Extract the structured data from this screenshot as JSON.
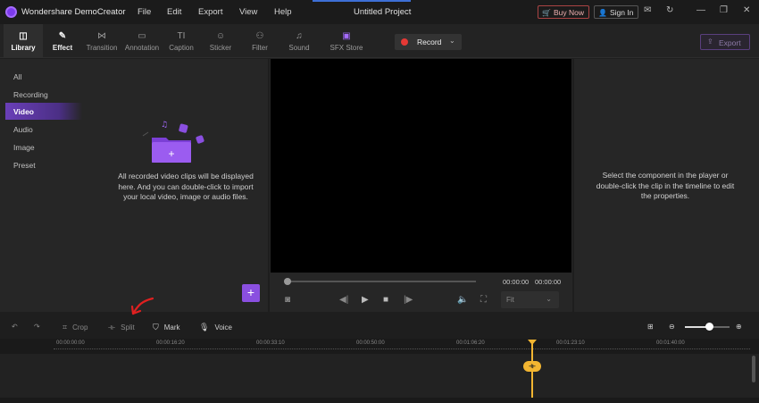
{
  "titlebar": {
    "app_name": "Wondershare DemoCreator",
    "menu": [
      "File",
      "Edit",
      "Export",
      "View",
      "Help"
    ],
    "project_title": "Untitled Project",
    "buy_label": "Buy Now",
    "signin_label": "Sign In"
  },
  "toolbar": {
    "tools": [
      {
        "label": "Library",
        "icon": "library-icon"
      },
      {
        "label": "Effect",
        "icon": "effect-icon"
      },
      {
        "label": "Transition",
        "icon": "transition-icon"
      },
      {
        "label": "Annotation",
        "icon": "annotation-icon"
      },
      {
        "label": "Caption",
        "icon": "caption-icon"
      },
      {
        "label": "Sticker",
        "icon": "sticker-icon"
      },
      {
        "label": "Filter",
        "icon": "filter-icon"
      },
      {
        "label": "Sound",
        "icon": "sound-icon"
      },
      {
        "label": "SFX Store",
        "icon": "sfx-store-icon"
      }
    ],
    "record_label": "Record",
    "export_label": "Export"
  },
  "sidebar": {
    "items": [
      {
        "label": "All"
      },
      {
        "label": "Recording"
      },
      {
        "label": "Video",
        "active": true
      },
      {
        "label": "Audio"
      },
      {
        "label": "Image"
      },
      {
        "label": "Preset"
      }
    ]
  },
  "library": {
    "empty_message": "All recorded video clips will be displayed here. And you can double-click to import your local video, image or audio files."
  },
  "player": {
    "current_time": "00:00:00",
    "total_time": "00:00:00",
    "fit_option": "Fit"
  },
  "properties": {
    "message": "Select the component in the player or double-click the clip in the timeline to edit the properties."
  },
  "timeline": {
    "tools": {
      "crop": "Crop",
      "split": "Split",
      "mark": "Mark",
      "voice": "Voice"
    },
    "ruler_ticks": [
      "00:00:00:00",
      "00:00:16:20",
      "00:00:33:10",
      "00:00:50:00",
      "00:01:06:20",
      "00:01:23:10",
      "00:01:40:00"
    ],
    "zoom_level": 0.55
  },
  "colors": {
    "accent": "#8a4fe0",
    "playhead": "#f2b531",
    "record": "#e53935"
  }
}
